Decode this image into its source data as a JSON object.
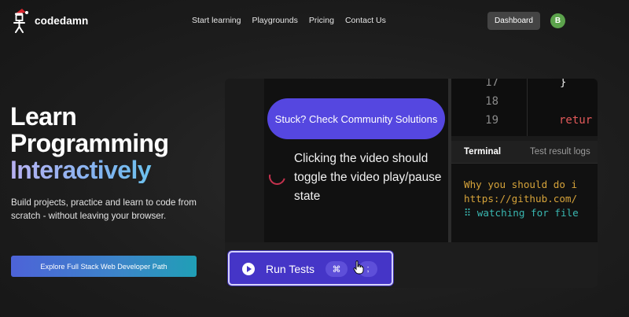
{
  "nav": {
    "brand": "codedamn",
    "links": [
      "Start learning",
      "Playgrounds",
      "Pricing",
      "Contact Us"
    ],
    "dashboard_label": "Dashboard",
    "avatar_initial": "B"
  },
  "hero": {
    "title_line1": "Learn",
    "title_line2": "Programming",
    "title_line3": "Interactively",
    "subtitle": "Build projects, practice and learn to code from scratch - without leaving your browser.",
    "cta_label": "Explore Full Stack Web Developer Path"
  },
  "demo": {
    "community_button": "Stuck? Check Community Solutions",
    "task_text": "Clicking the video should toggle the video play/pause state",
    "code": {
      "line_numbers": [
        "17",
        "18",
        "19"
      ],
      "line17": "}",
      "line19": "retur"
    },
    "terminal": {
      "tab_terminal": "Terminal",
      "tab_logs": "Test result logs",
      "line1": "Why you should do i",
      "line2": "https://github.com/",
      "line3": "⠿ watching for file"
    },
    "run_tests_label": "Run Tests",
    "shortcut_key1": "⌘",
    "shortcut_key2": ";"
  },
  "colors": {
    "accent_purple": "#5547e0",
    "run_button": "#4535c7",
    "terminal_yellow": "#d6a33a",
    "terminal_teal": "#39b7b1",
    "avatar_green": "#5ca34c"
  },
  "icons": [
    "codedamn-logo-icon",
    "spinner-icon",
    "play-icon",
    "pointer-cursor-icon"
  ]
}
